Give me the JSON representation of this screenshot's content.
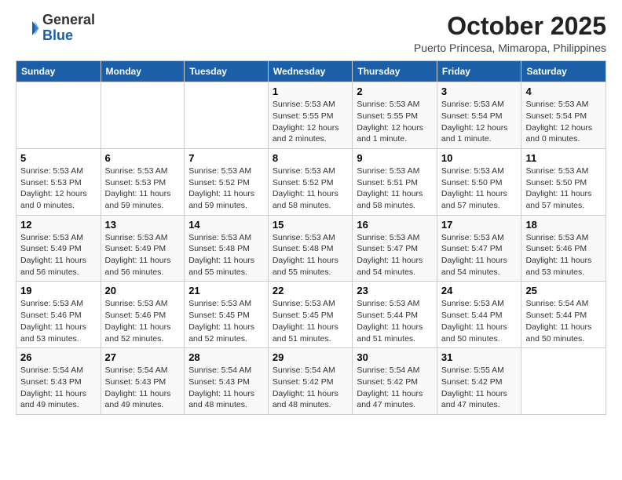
{
  "header": {
    "logo_general": "General",
    "logo_blue": "Blue",
    "month_title": "October 2025",
    "subtitle": "Puerto Princesa, Mimaropa, Philippines"
  },
  "days_of_week": [
    "Sunday",
    "Monday",
    "Tuesday",
    "Wednesday",
    "Thursday",
    "Friday",
    "Saturday"
  ],
  "weeks": [
    [
      {
        "day": "",
        "info": ""
      },
      {
        "day": "",
        "info": ""
      },
      {
        "day": "",
        "info": ""
      },
      {
        "day": "1",
        "info": "Sunrise: 5:53 AM\nSunset: 5:55 PM\nDaylight: 12 hours\nand 2 minutes."
      },
      {
        "day": "2",
        "info": "Sunrise: 5:53 AM\nSunset: 5:55 PM\nDaylight: 12 hours\nand 1 minute."
      },
      {
        "day": "3",
        "info": "Sunrise: 5:53 AM\nSunset: 5:54 PM\nDaylight: 12 hours\nand 1 minute."
      },
      {
        "day": "4",
        "info": "Sunrise: 5:53 AM\nSunset: 5:54 PM\nDaylight: 12 hours\nand 0 minutes."
      }
    ],
    [
      {
        "day": "5",
        "info": "Sunrise: 5:53 AM\nSunset: 5:53 PM\nDaylight: 12 hours\nand 0 minutes."
      },
      {
        "day": "6",
        "info": "Sunrise: 5:53 AM\nSunset: 5:53 PM\nDaylight: 11 hours\nand 59 minutes."
      },
      {
        "day": "7",
        "info": "Sunrise: 5:53 AM\nSunset: 5:52 PM\nDaylight: 11 hours\nand 59 minutes."
      },
      {
        "day": "8",
        "info": "Sunrise: 5:53 AM\nSunset: 5:52 PM\nDaylight: 11 hours\nand 58 minutes."
      },
      {
        "day": "9",
        "info": "Sunrise: 5:53 AM\nSunset: 5:51 PM\nDaylight: 11 hours\nand 58 minutes."
      },
      {
        "day": "10",
        "info": "Sunrise: 5:53 AM\nSunset: 5:50 PM\nDaylight: 11 hours\nand 57 minutes."
      },
      {
        "day": "11",
        "info": "Sunrise: 5:53 AM\nSunset: 5:50 PM\nDaylight: 11 hours\nand 57 minutes."
      }
    ],
    [
      {
        "day": "12",
        "info": "Sunrise: 5:53 AM\nSunset: 5:49 PM\nDaylight: 11 hours\nand 56 minutes."
      },
      {
        "day": "13",
        "info": "Sunrise: 5:53 AM\nSunset: 5:49 PM\nDaylight: 11 hours\nand 56 minutes."
      },
      {
        "day": "14",
        "info": "Sunrise: 5:53 AM\nSunset: 5:48 PM\nDaylight: 11 hours\nand 55 minutes."
      },
      {
        "day": "15",
        "info": "Sunrise: 5:53 AM\nSunset: 5:48 PM\nDaylight: 11 hours\nand 55 minutes."
      },
      {
        "day": "16",
        "info": "Sunrise: 5:53 AM\nSunset: 5:47 PM\nDaylight: 11 hours\nand 54 minutes."
      },
      {
        "day": "17",
        "info": "Sunrise: 5:53 AM\nSunset: 5:47 PM\nDaylight: 11 hours\nand 54 minutes."
      },
      {
        "day": "18",
        "info": "Sunrise: 5:53 AM\nSunset: 5:46 PM\nDaylight: 11 hours\nand 53 minutes."
      }
    ],
    [
      {
        "day": "19",
        "info": "Sunrise: 5:53 AM\nSunset: 5:46 PM\nDaylight: 11 hours\nand 53 minutes."
      },
      {
        "day": "20",
        "info": "Sunrise: 5:53 AM\nSunset: 5:46 PM\nDaylight: 11 hours\nand 52 minutes."
      },
      {
        "day": "21",
        "info": "Sunrise: 5:53 AM\nSunset: 5:45 PM\nDaylight: 11 hours\nand 52 minutes."
      },
      {
        "day": "22",
        "info": "Sunrise: 5:53 AM\nSunset: 5:45 PM\nDaylight: 11 hours\nand 51 minutes."
      },
      {
        "day": "23",
        "info": "Sunrise: 5:53 AM\nSunset: 5:44 PM\nDaylight: 11 hours\nand 51 minutes."
      },
      {
        "day": "24",
        "info": "Sunrise: 5:53 AM\nSunset: 5:44 PM\nDaylight: 11 hours\nand 50 minutes."
      },
      {
        "day": "25",
        "info": "Sunrise: 5:54 AM\nSunset: 5:44 PM\nDaylight: 11 hours\nand 50 minutes."
      }
    ],
    [
      {
        "day": "26",
        "info": "Sunrise: 5:54 AM\nSunset: 5:43 PM\nDaylight: 11 hours\nand 49 minutes."
      },
      {
        "day": "27",
        "info": "Sunrise: 5:54 AM\nSunset: 5:43 PM\nDaylight: 11 hours\nand 49 minutes."
      },
      {
        "day": "28",
        "info": "Sunrise: 5:54 AM\nSunset: 5:43 PM\nDaylight: 11 hours\nand 48 minutes."
      },
      {
        "day": "29",
        "info": "Sunrise: 5:54 AM\nSunset: 5:42 PM\nDaylight: 11 hours\nand 48 minutes."
      },
      {
        "day": "30",
        "info": "Sunrise: 5:54 AM\nSunset: 5:42 PM\nDaylight: 11 hours\nand 47 minutes."
      },
      {
        "day": "31",
        "info": "Sunrise: 5:55 AM\nSunset: 5:42 PM\nDaylight: 11 hours\nand 47 minutes."
      },
      {
        "day": "",
        "info": ""
      }
    ]
  ]
}
